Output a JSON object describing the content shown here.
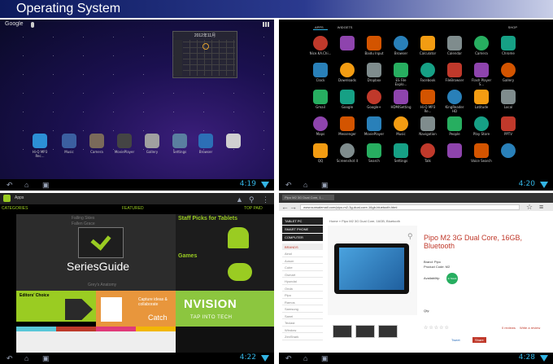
{
  "banner": {
    "title": "Operating System"
  },
  "colors": {
    "accent": "#33b5e5",
    "android_green": "#9acc22",
    "price_red": "#c0392b"
  },
  "panels": {
    "home": {
      "search_label": "Google",
      "calendar": {
        "header": "2012年11月"
      },
      "dock": [
        "Hi-Q MP3 Rec...",
        "Music",
        "Camera",
        "MoviePlayer",
        "Gallery",
        "Settings",
        "Browser",
        ""
      ],
      "clock": "4:19"
    },
    "drawer": {
      "tabs": [
        "APPS",
        "WIDGETS"
      ],
      "shop_label": "SHOP",
      "apps": [
        "Nice.KA.Chi...",
        "",
        "Baidu Input",
        "Browser",
        "Calculator",
        "Calendar",
        "Camera",
        "Chrome",
        "Clock",
        "Downloads",
        "Dropbox",
        "ES File Explo...",
        "Facebook",
        "FileBrowser",
        "Flash Player S...",
        "Gallery",
        "Gmail",
        "Google",
        "Google+",
        "HDMISetting",
        "Hi-Q MP3 Re...",
        "KingReader HD",
        "Latitude",
        "Local",
        "Maps",
        "Messenger",
        "MoviePlayer",
        "Music",
        "Navigation",
        "People",
        "Play Store",
        "PPTV",
        "QQ",
        "Screenshot it",
        "Search",
        "Settings",
        "Talk",
        "",
        "Voice Search",
        ""
      ],
      "clock": "4:20"
    },
    "store": {
      "title": "Apps",
      "tabs": [
        "CATEGORIES",
        "FEATURED",
        "TOP PAID"
      ],
      "series_guide": "SeriesGuide",
      "series_faded": [
        "Falling Skies",
        "Fallen Grace"
      ],
      "series_faded2": "Grey's Anatomy",
      "staff_picks": "Staff Picks for Tablets",
      "games": "Games",
      "editors_choice": "Editors' Choice",
      "capture_text": "Capture ideas & collaborate",
      "capture_brand": "Catch",
      "nvision": "NVISION",
      "nvision_sub": "TAP INTO TECH",
      "clock": "4:22"
    },
    "browser": {
      "tab_title": "Pipo M2 3G Dual Core, 1...",
      "url": "www.sunsalemall.com/pipo-m2-3g-dual-core-16gb-bluetooth.html",
      "categories": [
        "TABLET PC",
        "SMART PHONE",
        "COMPUTER"
      ],
      "brands_header": "BRANDS",
      "brands": [
        "Ainol",
        "Aoson",
        "Cube",
        "Gsmart",
        "Hyundai",
        "Onda",
        "Pipo",
        "Ramos",
        "Samsung",
        "Sanei",
        "Teclast",
        "Window",
        "ZenShark"
      ],
      "breadcrumb": "Home » Pipo M2 3G Dual Core, 16GB, Bluetooth",
      "product_title": "Pipo M2 3G Dual Core, 16GB, Bluetooth",
      "brand_line": "Brand: Pipo",
      "code_line": "Product Code: M2",
      "availability_label": "Availability:",
      "availability_badge": "In Stock",
      "qty_label": "Qty:",
      "reviews": "0 reviews",
      "write_review": "Write a review",
      "tweet": "Tweet",
      "share": "Share",
      "clock": "4:28"
    }
  }
}
